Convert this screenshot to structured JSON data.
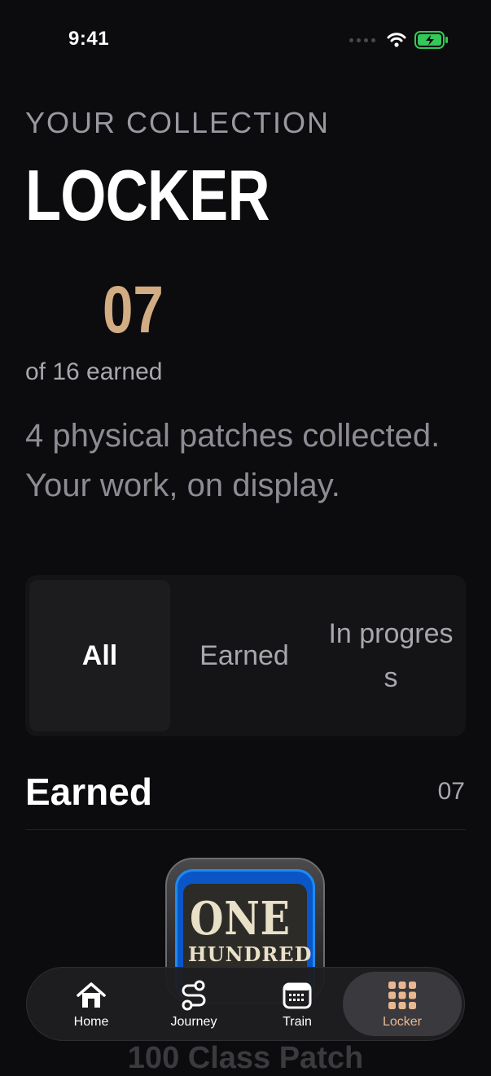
{
  "status_bar": {
    "time": "9:41"
  },
  "header": {
    "eyebrow": "YOUR COLLECTION",
    "title": "LOCKER"
  },
  "stats": {
    "earned_count": "07",
    "earned_of_total": "of 16 earned",
    "summary": "4 physical patches collected. Your work, on display."
  },
  "filter": {
    "options": [
      "All",
      "Earned",
      "In progres s"
    ],
    "selected": "All"
  },
  "section": {
    "title": "Earned",
    "count": "07"
  },
  "patches": [
    {
      "line1": "ONE",
      "line2": "HUNDRED",
      "caption": "100 Class Patch"
    }
  ],
  "tabbar": {
    "items": [
      {
        "label": "Home",
        "icon": "home-icon"
      },
      {
        "label": "Journey",
        "icon": "route-icon"
      },
      {
        "label": "Train",
        "icon": "calendar-icon"
      },
      {
        "label": "Locker",
        "icon": "grid-icon"
      }
    ],
    "active": "Locker"
  },
  "colors": {
    "background": "#0c0b0d",
    "accent_gold": "#d2ac82",
    "active_tab_text": "#e8b892",
    "battery_green": "#34c759"
  }
}
